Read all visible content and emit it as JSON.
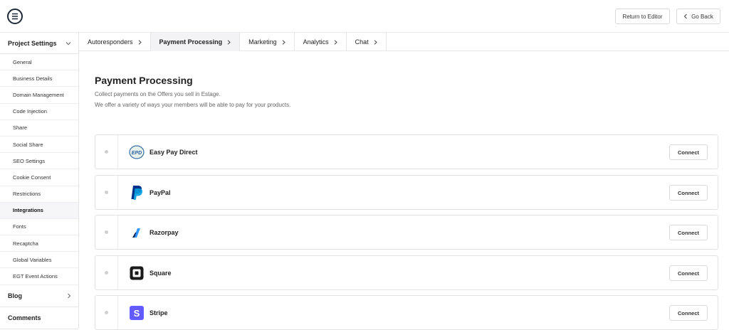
{
  "header": {
    "return_label": "Return to Editor",
    "back_label": "Go Back",
    "back_icon": "chevron-left-icon"
  },
  "sidebar": {
    "section_title": "Project Settings",
    "items": [
      {
        "label": "General",
        "active": false
      },
      {
        "label": "Business Details",
        "active": false
      },
      {
        "label": "Domain Management",
        "active": false
      },
      {
        "label": "Code Injection",
        "active": false
      },
      {
        "label": "Share",
        "active": false
      },
      {
        "label": "Social Share",
        "active": false
      },
      {
        "label": "SEO Settings",
        "active": false
      },
      {
        "label": "Cookie Consent",
        "active": false
      },
      {
        "label": "Restrictions",
        "active": false
      },
      {
        "label": "Integrations",
        "active": true
      },
      {
        "label": "Fonts",
        "active": false
      },
      {
        "label": "Recaptcha",
        "active": false
      },
      {
        "label": "Global Variables",
        "active": false
      },
      {
        "label": "EGT Event Actions",
        "active": false
      }
    ],
    "groups": [
      {
        "label": "Blog",
        "chevron": "chevron-right-icon"
      },
      {
        "label": "Comments"
      }
    ]
  },
  "tabs": [
    {
      "label": "Autoresponders",
      "active": false
    },
    {
      "label": "Payment Processing",
      "active": true
    },
    {
      "label": "Marketing",
      "active": false
    },
    {
      "label": "Analytics",
      "active": false
    },
    {
      "label": "Chat",
      "active": false
    }
  ],
  "main": {
    "title": "Payment Processing",
    "desc1": "Collect payments on the Offers you sell in Estage.",
    "desc2": "We offer a variety of ways your members will be able to pay for your products.",
    "providers": [
      {
        "name": "Easy Pay Direct",
        "icon": "easy-pay-direct-logo-icon",
        "connect_label": "Connect"
      },
      {
        "name": "PayPal",
        "icon": "paypal-logo-icon",
        "connect_label": "Connect"
      },
      {
        "name": "Razorpay",
        "icon": "razorpay-logo-icon",
        "connect_label": "Connect"
      },
      {
        "name": "Square",
        "icon": "square-logo-icon",
        "connect_label": "Connect"
      },
      {
        "name": "Stripe",
        "icon": "stripe-logo-icon",
        "connect_label": "Connect"
      }
    ]
  },
  "colors": {
    "paypal_dark": "#003087",
    "paypal_light": "#009cde",
    "razorpay": "#3395ff",
    "stripe": "#635bff",
    "square": "#1a1a1a",
    "active_bg": "#f3f3f5"
  }
}
